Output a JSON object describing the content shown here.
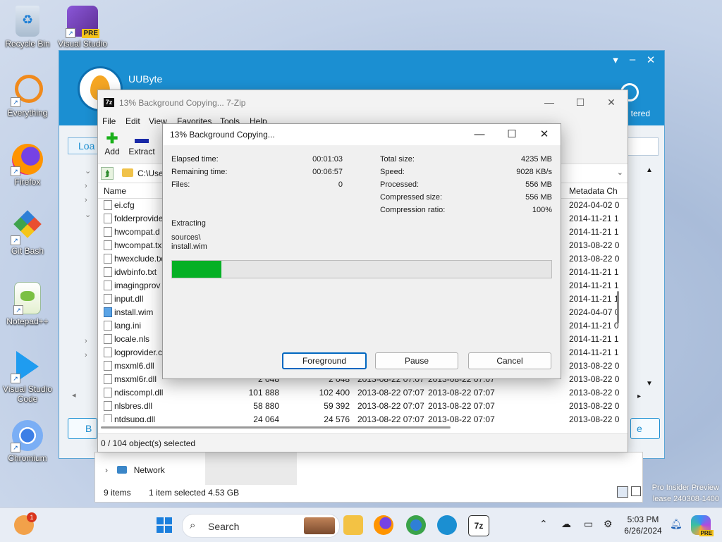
{
  "desktop": {
    "icons": [
      {
        "label": "Recycle Bin"
      },
      {
        "label": "Visual Studio",
        "badge": "PRE"
      },
      {
        "label": "Everything"
      },
      {
        "label": "Firefox"
      },
      {
        "label": "Git Bash"
      },
      {
        "label": "Notepad++"
      },
      {
        "label": "Visual Studio Code"
      },
      {
        "label": "Chromium"
      }
    ],
    "watermark_line1": "Pro Insider Preview",
    "watermark_line2": "lease 240308-1400"
  },
  "uubyte": {
    "brand": "UUByte",
    "registered_label": "tered",
    "load_label": "Loa",
    "big_left_label": "B",
    "big_right_label": "e"
  },
  "explorer": {
    "network_label": "Network",
    "items_count": "9 items",
    "selection": "1 item selected  4.53 GB"
  },
  "zip": {
    "title": "13% Background Copying... 7-Zip",
    "app_icon": "7z",
    "menu": [
      "File",
      "Edit",
      "View",
      "Favorites",
      "Tools",
      "Help"
    ],
    "toolbar": {
      "add": "Add",
      "extract": "Extract"
    },
    "path": "C:\\Use",
    "columns": {
      "name": "Name",
      "metadata": "Metadata Ch"
    },
    "rows": [
      {
        "name": "ei.cfg",
        "size": "",
        "packed": "",
        "modified": "",
        "created": "",
        "meta": "2024-04-02 0"
      },
      {
        "name": "folderprovide",
        "size": "",
        "packed": "",
        "modified": "",
        "created": "",
        "meta": "2014-11-21 1"
      },
      {
        "name": "hwcompat.d",
        "size": "",
        "packed": "",
        "modified": "",
        "created": "",
        "meta": "2014-11-21 1"
      },
      {
        "name": "hwcompat.tx",
        "size": "",
        "packed": "",
        "modified": "",
        "created": "",
        "meta": "2013-08-22 0"
      },
      {
        "name": "hwexclude.tx",
        "size": "",
        "packed": "",
        "modified": "",
        "created": "",
        "meta": "2013-08-22 0"
      },
      {
        "name": "idwbinfo.txt",
        "size": "",
        "packed": "",
        "modified": "",
        "created": "",
        "meta": "2014-11-21 1"
      },
      {
        "name": "imagingprov",
        "size": "",
        "packed": "",
        "modified": "",
        "created": "",
        "meta": "2014-11-21 1"
      },
      {
        "name": "input.dll",
        "size": "",
        "packed": "",
        "modified": "",
        "created": "",
        "meta": "2014-11-21 1"
      },
      {
        "name": "install.wim",
        "size": "",
        "packed": "",
        "modified": "",
        "created": "",
        "meta": "2024-04-07 0",
        "wim": true
      },
      {
        "name": "lang.ini",
        "size": "",
        "packed": "",
        "modified": "",
        "created": "",
        "meta": "2014-11-21 0"
      },
      {
        "name": "locale.nls",
        "size": "",
        "packed": "",
        "modified": "",
        "created": "",
        "meta": "2014-11-21 1"
      },
      {
        "name": "logprovider.c",
        "size": "",
        "packed": "",
        "modified": "",
        "created": "",
        "meta": "2014-11-21 1"
      },
      {
        "name": "msxml6.dll",
        "size": "",
        "packed": "",
        "modified": "",
        "created": "",
        "meta": "2013-08-22 0"
      },
      {
        "name": "msxml6r.dll",
        "size": "2 048",
        "packed": "2 048",
        "modified": "2013-08-22 07:07",
        "created": "2013-08-22 07:07",
        "meta": "2013-08-22 0"
      },
      {
        "name": "ndiscompl.dll",
        "size": "101 888",
        "packed": "102 400",
        "modified": "2013-08-22 07:07",
        "created": "2013-08-22 07:07",
        "meta": "2013-08-22 0"
      },
      {
        "name": "nlsbres.dll",
        "size": "58 880",
        "packed": "59 392",
        "modified": "2013-08-22 07:07",
        "created": "2013-08-22 07:07",
        "meta": "2013-08-22 0"
      },
      {
        "name": "ntdsupg.dll",
        "size": "24 064",
        "packed": "24 576",
        "modified": "2013-08-22 07:07",
        "created": "2013-08-22 07:07",
        "meta": "2013-08-22 0"
      }
    ],
    "status": "0 / 104 object(s) selected"
  },
  "dialog": {
    "title": "13% Background Copying...",
    "elapsed_label": "Elapsed time:",
    "elapsed": "00:01:03",
    "remaining_label": "Remaining time:",
    "remaining": "00:06:57",
    "files_label": "Files:",
    "files": "0",
    "total_label": "Total size:",
    "total": "4235 MB",
    "speed_label": "Speed:",
    "speed": "9028 KB/s",
    "processed_label": "Processed:",
    "processed": "556 MB",
    "compressed_label": "Compressed size:",
    "compressed": "556 MB",
    "ratio_label": "Compression ratio:",
    "ratio": "100%",
    "operation": "Extracting",
    "path_line1": "sources\\",
    "path_line2": "install.wim",
    "progress": 0.13,
    "progress_color": "#06b025",
    "buttons": {
      "foreground": "Foreground",
      "pause": "Pause",
      "cancel": "Cancel"
    }
  },
  "taskbar": {
    "search_placeholder": "Search",
    "time": "5:03 PM",
    "date": "6/26/2024",
    "notification_badge": "1",
    "zip_label": "7z",
    "copilot_badge": "PRE"
  }
}
